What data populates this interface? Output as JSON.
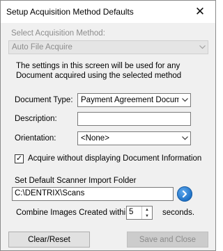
{
  "window": {
    "title": "Setup Acquisition Method Defaults",
    "close_glyph": "✕"
  },
  "acquisition": {
    "label": "Select Acquisition Method:",
    "selected": "Auto File Acquire"
  },
  "info": {
    "line1": "The settings in this screen will be used for any",
    "line2": "Document acquired using the selected method"
  },
  "document_type": {
    "label": "Document Type:",
    "selected": "Payment Agreement Documer"
  },
  "description": {
    "label": "Description:",
    "value": ""
  },
  "orientation": {
    "label": "Orientation:",
    "selected": "<None>"
  },
  "acquire_option": {
    "label": "Acquire without displaying Document Information",
    "checked": true,
    "check_glyph": "✓"
  },
  "scanner_folder": {
    "label": "Set Default  Scanner Import Folder",
    "value": "C:\\DENTRIX\\Scans"
  },
  "combine": {
    "label": "Combine Images Created within",
    "value": "5",
    "unit": "seconds."
  },
  "buttons": {
    "clear": "Clear/Reset",
    "save": "Save and Close"
  },
  "icons": {
    "combo_arrow": "chevron-down-icon",
    "go": "arrow-right-circle-icon",
    "spin_up": "▲",
    "spin_down": "▼"
  },
  "colors": {
    "go_button": "#1c6fc4",
    "dialog_bg": "#f0f0f0",
    "disabled_text": "#8c8c8c"
  }
}
